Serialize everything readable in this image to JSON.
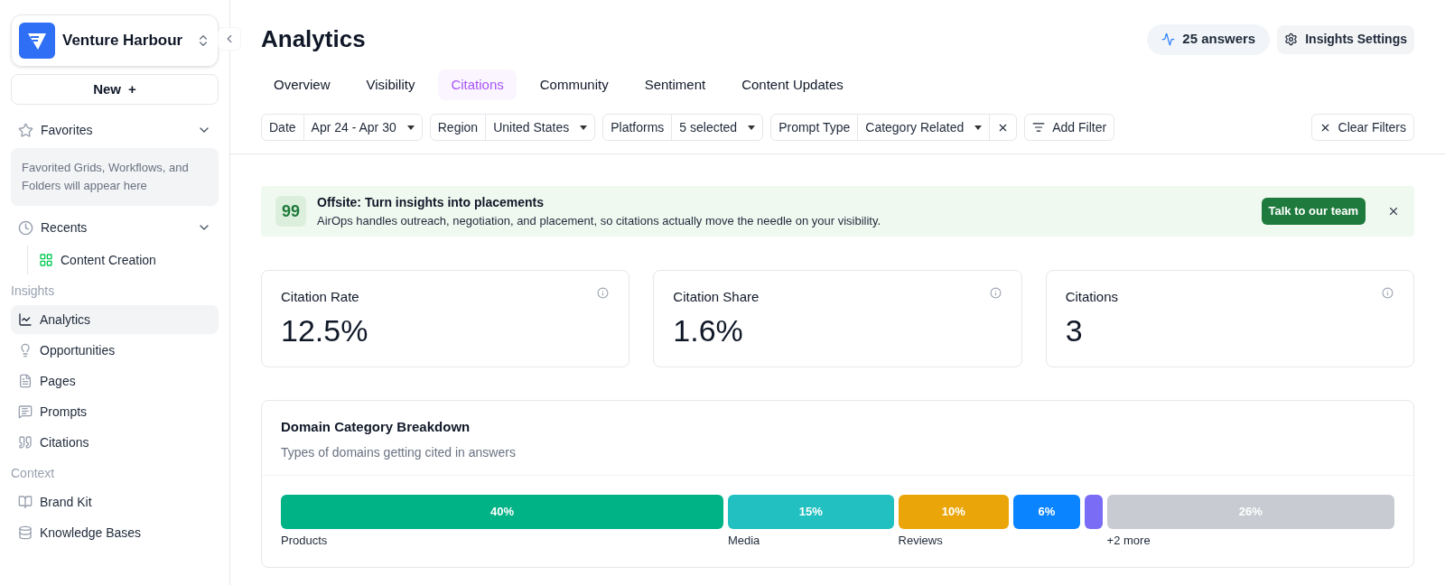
{
  "workspace": {
    "name": "Venture Harbour"
  },
  "new_button": {
    "label": "New",
    "icon": "+"
  },
  "favorites": {
    "label": "Favorites",
    "expanded": true,
    "empty_text": "Favorited Grids, Workflows, and Folders will appear here"
  },
  "recents": {
    "label": "Recents",
    "expanded": true,
    "items": [
      {
        "label": "Content Creation"
      }
    ]
  },
  "sections": [
    {
      "title": "Insights",
      "items": [
        {
          "label": "Analytics",
          "selected": true
        },
        {
          "label": "Opportunities",
          "selected": false
        },
        {
          "label": "Pages",
          "selected": false
        },
        {
          "label": "Prompts",
          "selected": false
        },
        {
          "label": "Citations",
          "selected": false
        }
      ]
    },
    {
      "title": "Context",
      "items": [
        {
          "label": "Brand Kit",
          "selected": false
        },
        {
          "label": "Knowledge Bases",
          "selected": false
        }
      ]
    }
  ],
  "page": {
    "title": "Analytics",
    "answers": "25 answers",
    "settings_button": "Insights Settings"
  },
  "tabs": [
    {
      "label": "Overview",
      "selected": false
    },
    {
      "label": "Visibility",
      "selected": false
    },
    {
      "label": "Citations",
      "selected": true
    },
    {
      "label": "Community",
      "selected": false
    },
    {
      "label": "Sentiment",
      "selected": false
    },
    {
      "label": "Content Updates",
      "selected": false
    }
  ],
  "filters": [
    {
      "name": "Date",
      "value": "Apr 24 - Apr 30",
      "removable": false
    },
    {
      "name": "Region",
      "value": "United States",
      "removable": false
    },
    {
      "name": "Platforms",
      "value": "5 selected",
      "removable": false
    },
    {
      "name": "Prompt Type",
      "value": "Category Related",
      "removable": true
    }
  ],
  "add_filter": "Add Filter",
  "clear_filters": "Clear Filters",
  "banner": {
    "icon": "99",
    "title": "Offsite: Turn insights into placements",
    "text": "AirOps handles outreach, negotiation, and placement, so citations actually move the needle on your visibility.",
    "button": "Talk to our team"
  },
  "metrics": [
    {
      "label": "Citation Rate",
      "value": "12.5%"
    },
    {
      "label": "Citation Share",
      "value": "1.6%"
    },
    {
      "label": "Citations",
      "value": "3"
    }
  ],
  "breakdown": {
    "title": "Domain Category Breakdown",
    "subtitle": "Types of domains getting cited in answers",
    "segments": [
      {
        "value_label": "40%",
        "name": "Products",
        "color": "#00b386"
      },
      {
        "value_label": "15%",
        "name": "Media",
        "color": "#22c0c0"
      },
      {
        "value_label": "10%",
        "name": "Reviews",
        "color": "#eaa608"
      },
      {
        "value_label": "6%",
        "color": "#0a84ff"
      },
      {
        "color": "#7b6cf6"
      },
      {
        "value_label": "26%",
        "name": "+2 more",
        "color": "#c8cbd2"
      }
    ]
  }
}
